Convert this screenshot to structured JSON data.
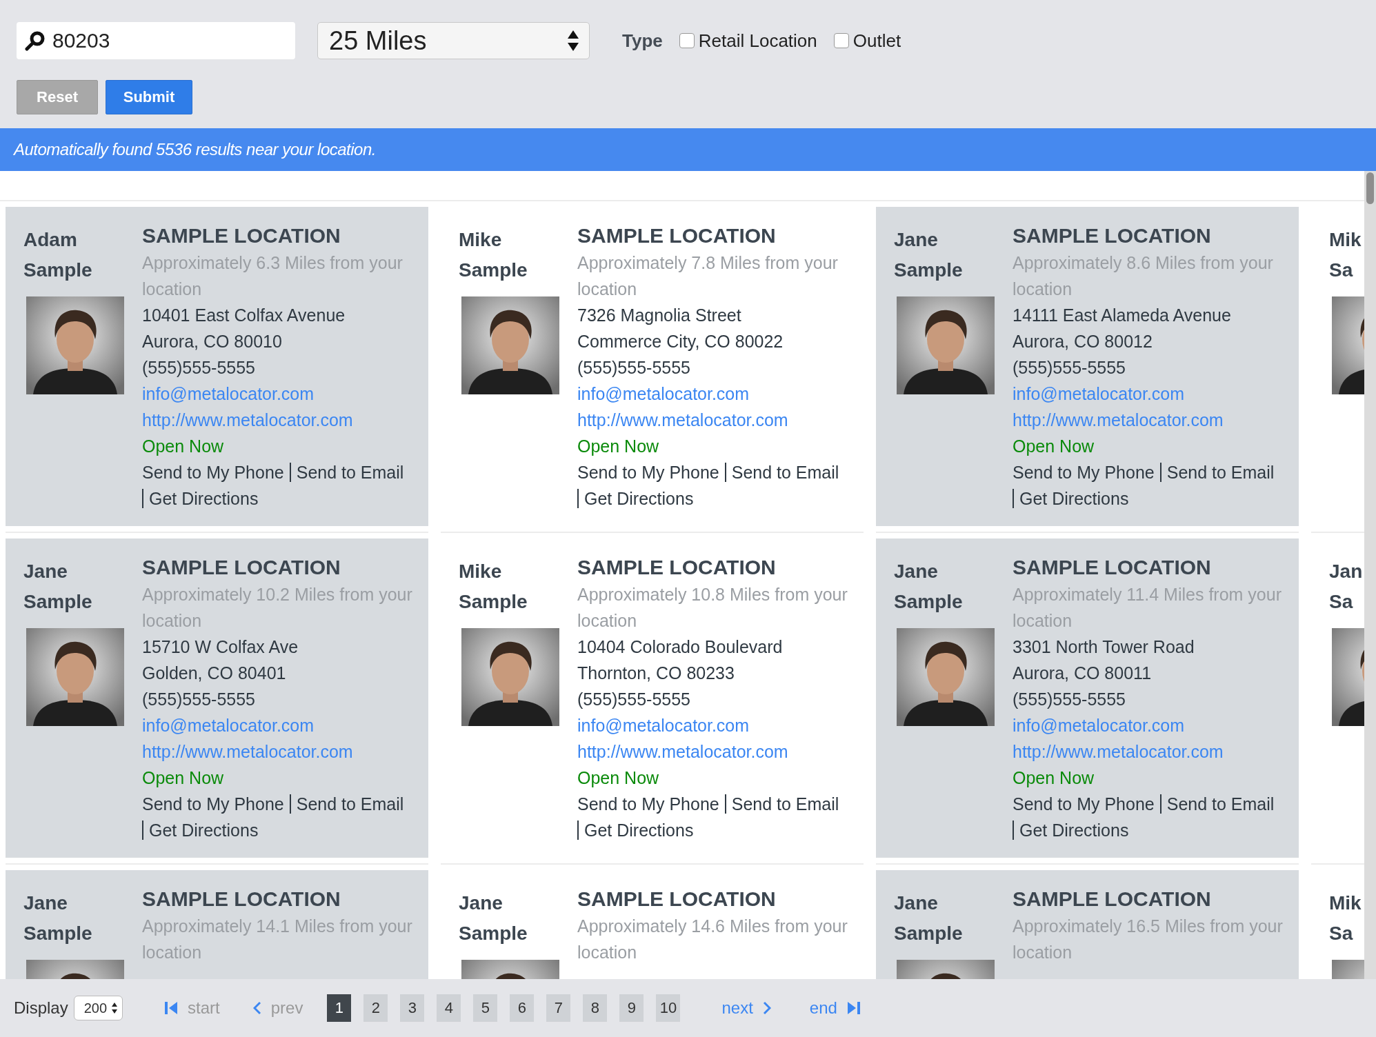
{
  "search": {
    "value": "80203"
  },
  "radius": {
    "value": "25 Miles"
  },
  "type_filter": {
    "label": "Type",
    "options": [
      {
        "label": "Retail Location",
        "checked": false
      },
      {
        "label": "Outlet",
        "checked": false
      }
    ]
  },
  "buttons": [
    {
      "label": "Reset",
      "kind": "reset"
    },
    {
      "label": "Submit",
      "kind": "submit"
    }
  ],
  "banner": "Automatically found 5536 results near your location.",
  "cards": [
    {
      "name": "Adam Sample",
      "title": "SAMPLE LOCATION",
      "distance": "Approximately 6.3 Miles from your location",
      "address_lines": [
        "10401 East Colfax Avenue",
        "Aurora, CO 80010"
      ],
      "phone": "(555)555-5555",
      "email": "info@metalocator.com",
      "website": "http://www.metalocator.com",
      "status": "Open Now",
      "actions": [
        "Send to My Phone",
        "Send to Email",
        "Get Directions"
      ],
      "photo": {
        "kind": "picture"
      }
    },
    {
      "name": "Mike Sample",
      "title": "SAMPLE LOCATION",
      "distance": "Approximately 7.8 Miles from your location",
      "address_lines": [
        "7326 Magnolia Street",
        "Commerce City, CO 80022"
      ],
      "phone": "(555)555-5555",
      "email": "info@metalocator.com",
      "website": "http://www.metalocator.com",
      "status": "Open Now",
      "actions": [
        "Send to My Phone",
        "Send to Email",
        "Get Directions"
      ],
      "photo": {
        "kind": "picture"
      }
    },
    {
      "name": "Jane Sample",
      "title": "SAMPLE LOCATION",
      "distance": "Approximately 8.6 Miles from your location",
      "address_lines": [
        "14111 East Alameda Avenue",
        "Aurora, CO 80012"
      ],
      "phone": "(555)555-5555",
      "email": "info@metalocator.com",
      "website": "http://www.metalocator.com",
      "status": "Open Now",
      "actions": [
        "Send to My Phone",
        "Send to Email",
        "Get Directions"
      ],
      "photo": {
        "kind": "picture"
      }
    },
    {
      "name": "Mik Sa",
      "photo": {
        "kind": "picture"
      }
    },
    {
      "name": "Jane Sample",
      "title": "SAMPLE LOCATION",
      "distance": "Approximately 10.2 Miles from your location",
      "address_lines": [
        "15710 W Colfax Ave",
        "Golden, CO 80401"
      ],
      "phone": "(555)555-5555",
      "email": "info@metalocator.com",
      "website": "http://www.metalocator.com",
      "status": "Open Now",
      "actions": [
        "Send to My Phone",
        "Send to Email",
        "Get Directions"
      ],
      "photo": {
        "kind": "picture"
      }
    },
    {
      "name": "Mike Sample",
      "title": "SAMPLE LOCATION",
      "distance": "Approximately 10.8 Miles from your location",
      "address_lines": [
        "10404 Colorado Boulevard",
        "Thornton, CO 80233"
      ],
      "phone": "(555)555-5555",
      "email": "info@metalocator.com",
      "website": "http://www.metalocator.com",
      "status": "Open Now",
      "actions": [
        "Send to My Phone",
        "Send to Email",
        "Get Directions"
      ],
      "photo": {
        "kind": "picture"
      }
    },
    {
      "name": "Jane Sample",
      "title": "SAMPLE LOCATION",
      "distance": "Approximately 11.4 Miles from your location",
      "address_lines": [
        "3301 North Tower Road",
        "Aurora, CO 80011"
      ],
      "phone": "(555)555-5555",
      "email": "info@metalocator.com",
      "website": "http://www.metalocator.com",
      "status": "Open Now",
      "actions": [
        "Send to My Phone",
        "Send to Email",
        "Get Directions"
      ],
      "photo": {
        "kind": "picture"
      }
    },
    {
      "name": "Jan Sa",
      "photo": {
        "kind": "picture"
      }
    },
    {
      "name": "Jane Sample",
      "title": "SAMPLE LOCATION",
      "distance": "Approximately 14.1 Miles from your location",
      "photo": {
        "kind": "picture"
      }
    },
    {
      "name": "Jane Sample",
      "title": "SAMPLE LOCATION",
      "distance": "Approximately 14.6 Miles from your location",
      "photo": {
        "kind": "picture"
      }
    },
    {
      "name": "Jane Sample",
      "title": "SAMPLE LOCATION",
      "distance": "Approximately 16.5 Miles from your location",
      "photo": {
        "kind": "picture"
      }
    },
    {
      "name": "Mik Sa",
      "photo": {
        "kind": "picture"
      }
    }
  ],
  "pager": {
    "display_label": "Display",
    "display_value": "200",
    "start": {
      "label": "start",
      "disabled": true
    },
    "prev": {
      "label": "prev",
      "disabled": true
    },
    "pages": [
      {
        "label": "1",
        "selected": true
      },
      {
        "label": "2",
        "selected": false
      },
      {
        "label": "3",
        "selected": false
      },
      {
        "label": "4",
        "selected": false
      },
      {
        "label": "5",
        "selected": false
      },
      {
        "label": "6",
        "selected": false
      },
      {
        "label": "7",
        "selected": false
      },
      {
        "label": "8",
        "selected": false
      },
      {
        "label": "9",
        "selected": false
      },
      {
        "label": "10",
        "selected": false
      }
    ],
    "next": {
      "label": "next",
      "disabled": false
    },
    "end": {
      "label": "end",
      "disabled": false
    }
  }
}
